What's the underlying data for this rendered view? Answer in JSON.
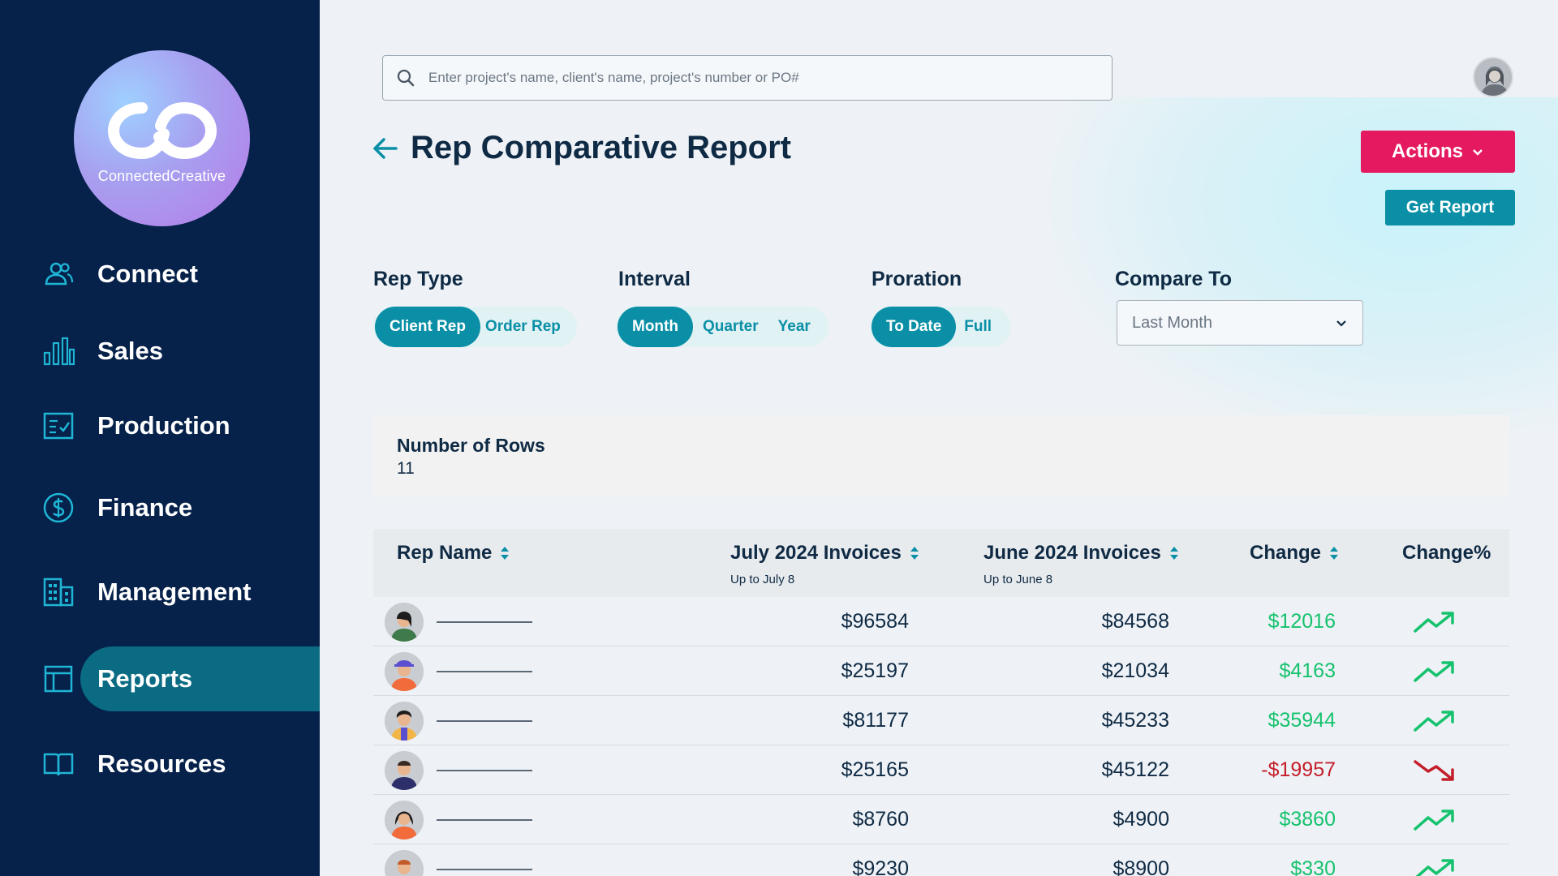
{
  "sidebar": {
    "logo_text": "ConnectedCreative",
    "items": [
      {
        "label": "Connect",
        "icon": "users-icon"
      },
      {
        "label": "Sales",
        "icon": "bar-chart-icon"
      },
      {
        "label": "Production",
        "icon": "checklist-icon"
      },
      {
        "label": "Finance",
        "icon": "dollar-icon"
      },
      {
        "label": "Management",
        "icon": "building-icon"
      },
      {
        "label": "Reports",
        "icon": "table-icon",
        "active": true
      },
      {
        "label": "Resources",
        "icon": "book-icon"
      }
    ]
  },
  "search": {
    "placeholder": "Enter project's name, client's name, project's number or PO#"
  },
  "header": {
    "title": "Rep Comparative Report",
    "actions_label": "Actions",
    "get_report_label": "Get Report"
  },
  "filters": {
    "rep_type": {
      "label": "Rep Type",
      "options": [
        "Client Rep",
        "Order Rep"
      ],
      "selected": "Client Rep"
    },
    "interval": {
      "label": "Interval",
      "options": [
        "Month",
        "Quarter",
        "Year"
      ],
      "selected": "Month"
    },
    "proration": {
      "label": "Proration",
      "options": [
        "To Date",
        "Full"
      ],
      "selected": "To Date"
    },
    "compare_to": {
      "label": "Compare To",
      "value": "Last Month"
    }
  },
  "summary": {
    "rows_label": "Number of Rows",
    "rows_value": "11"
  },
  "table": {
    "columns": {
      "rep_name": "Rep Name",
      "july": "July 2024 Invoices",
      "july_sub": "Up to July 8",
      "june": "June 2024 Invoices",
      "june_sub": "Up to June 8",
      "change": "Change",
      "change_pct": "Change%"
    },
    "rows": [
      {
        "july": "$96584",
        "june": "$84568",
        "change": "$12016",
        "trend": "up"
      },
      {
        "july": "$25197",
        "june": "$21034",
        "change": "$4163",
        "trend": "up"
      },
      {
        "july": "$81177",
        "june": "$45233",
        "change": "$35944",
        "trend": "up"
      },
      {
        "july": "$25165",
        "june": "$45122",
        "change": "-$19957",
        "trend": "down"
      },
      {
        "july": "$8760",
        "june": "$4900",
        "change": "$3860",
        "trend": "up"
      },
      {
        "july": "$9230",
        "june": "$8900",
        "change": "$330",
        "trend": "up"
      }
    ]
  },
  "colors": {
    "sidebar_bg": "#06214a",
    "accent_teal": "#0a8fa6",
    "actions_pink": "#e5195f",
    "positive": "#16c26e",
    "negative": "#c41e2a"
  }
}
